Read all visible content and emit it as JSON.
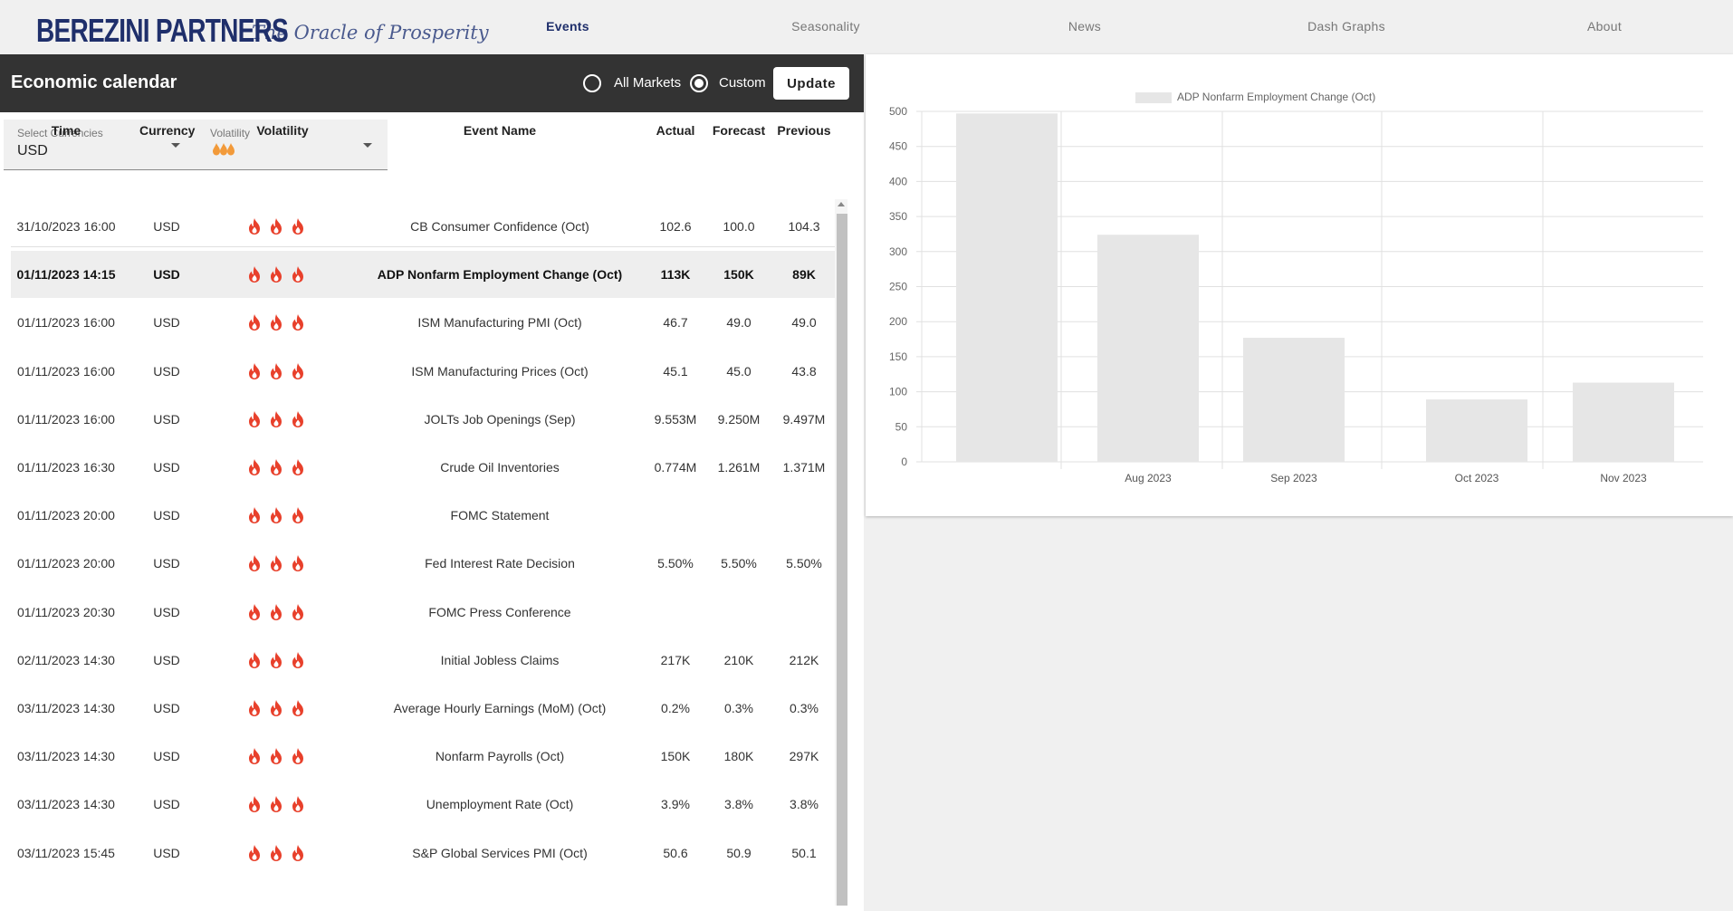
{
  "brand": {
    "name": "BEREZINI PARTNERS",
    "tagline": "The Oracle of Prosperity"
  },
  "nav": [
    "Events",
    "Seasonality",
    "News",
    "Dash Graphs",
    "About"
  ],
  "calendar": {
    "title": "Economic calendar",
    "radio_all": "All Markets",
    "radio_custom": "Custom",
    "selected": "Custom",
    "update_label": "Update",
    "currency_label": "Select Currencies",
    "currency_value": "USD",
    "volatility_label": "Volatility",
    "volatility_level": 3
  },
  "table": {
    "headers": [
      "Time",
      "Currency",
      "Volatility",
      "Event Name",
      "Actual",
      "Forecast",
      "Previous"
    ],
    "rows": [
      {
        "time": "31/10/2023 16:00",
        "currency": "USD",
        "volatility": 3,
        "event": "CB Consumer Confidence (Oct)",
        "actual": "102.6",
        "forecast": "100.0",
        "previous": "104.3"
      },
      {
        "time": "01/11/2023 14:15",
        "currency": "USD",
        "volatility": 3,
        "event": "ADP Nonfarm Employment Change (Oct)",
        "actual": "113K",
        "forecast": "150K",
        "previous": "89K",
        "selected": true
      },
      {
        "time": "01/11/2023 16:00",
        "currency": "USD",
        "volatility": 3,
        "event": "ISM Manufacturing PMI (Oct)",
        "actual": "46.7",
        "forecast": "49.0",
        "previous": "49.0"
      },
      {
        "time": "01/11/2023 16:00",
        "currency": "USD",
        "volatility": 3,
        "event": "ISM Manufacturing Prices (Oct)",
        "actual": "45.1",
        "forecast": "45.0",
        "previous": "43.8"
      },
      {
        "time": "01/11/2023 16:00",
        "currency": "USD",
        "volatility": 3,
        "event": "JOLTs Job Openings (Sep)",
        "actual": "9.553M",
        "forecast": "9.250M",
        "previous": "9.497M"
      },
      {
        "time": "01/11/2023 16:30",
        "currency": "USD",
        "volatility": 3,
        "event": "Crude Oil Inventories",
        "actual": "0.774M",
        "forecast": "1.261M",
        "previous": "1.371M"
      },
      {
        "time": "01/11/2023 20:00",
        "currency": "USD",
        "volatility": 3,
        "event": "FOMC Statement",
        "actual": "",
        "forecast": "",
        "previous": ""
      },
      {
        "time": "01/11/2023 20:00",
        "currency": "USD",
        "volatility": 3,
        "event": "Fed Interest Rate Decision",
        "actual": "5.50%",
        "forecast": "5.50%",
        "previous": "5.50%"
      },
      {
        "time": "01/11/2023 20:30",
        "currency": "USD",
        "volatility": 3,
        "event": "FOMC Press Conference",
        "actual": "",
        "forecast": "",
        "previous": ""
      },
      {
        "time": "02/11/2023 14:30",
        "currency": "USD",
        "volatility": 3,
        "event": "Initial Jobless Claims",
        "actual": "217K",
        "forecast": "210K",
        "previous": "212K"
      },
      {
        "time": "03/11/2023 14:30",
        "currency": "USD",
        "volatility": 3,
        "event": "Average Hourly Earnings (MoM) (Oct)",
        "actual": "0.2%",
        "forecast": "0.3%",
        "previous": "0.3%"
      },
      {
        "time": "03/11/2023 14:30",
        "currency": "USD",
        "volatility": 3,
        "event": "Nonfarm Payrolls (Oct)",
        "actual": "150K",
        "forecast": "180K",
        "previous": "297K"
      },
      {
        "time": "03/11/2023 14:30",
        "currency": "USD",
        "volatility": 3,
        "event": "Unemployment Rate (Oct)",
        "actual": "3.9%",
        "forecast": "3.8%",
        "previous": "3.8%"
      },
      {
        "time": "03/11/2023 15:45",
        "currency": "USD",
        "volatility": 3,
        "event": "S&P Global Services PMI (Oct)",
        "actual": "50.6",
        "forecast": "50.9",
        "previous": "50.1"
      }
    ]
  },
  "colors": {
    "flame": "#e8402b",
    "flame_light": "#f29a3a",
    "bar": "#e6e6e6",
    "brand": "#1f2f6b"
  },
  "chart_data": {
    "type": "bar",
    "title": "",
    "legend": [
      "ADP Nonfarm Employment Change (Oct)"
    ],
    "categories": [
      "",
      "Aug 2023",
      "Sep 2023",
      "Oct 2023",
      "Nov 2023"
    ],
    "series": [
      {
        "name": "ADP Nonfarm Employment Change (Oct)",
        "values": [
          497,
          324,
          177,
          89,
          113
        ]
      }
    ],
    "ylim": [
      0,
      500
    ],
    "yticks": [
      0,
      50,
      100,
      150,
      200,
      250,
      300,
      350,
      400,
      450,
      500
    ],
    "grid": true,
    "legend_position": "top"
  }
}
